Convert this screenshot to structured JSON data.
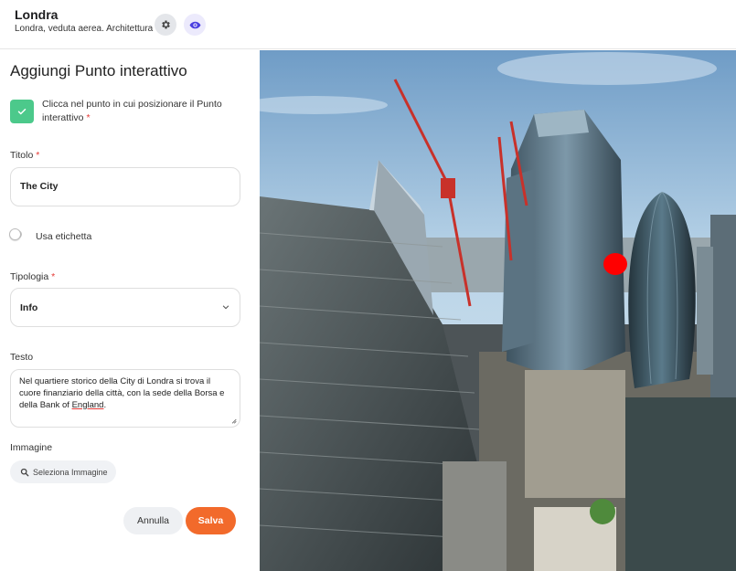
{
  "header": {
    "title": "Londra",
    "subtitle": "Londra, veduta aerea. Architettura",
    "settings_icon": "gear-icon",
    "preview_icon": "eye-icon"
  },
  "panel": {
    "title": "Aggiungi Punto interattivo",
    "instruction": "Clicca nel punto in cui posizionare il Punto interattivo",
    "required_mark": "*",
    "title_field": {
      "label": "Titolo",
      "value": "The City"
    },
    "label_toggle": {
      "label": "Usa etichetta",
      "checked": false
    },
    "type_field": {
      "label": "Tipologia",
      "value": "Info"
    },
    "text_field": {
      "label": "Testo",
      "value_before": "Nel quartiere storico della City di Londra si trova il cuore finanziario della città, con la sede della Borsa e della Bank of ",
      "value_underlined": "England",
      "value_after": "."
    },
    "image_field": {
      "label": "Immagine",
      "button_label": "Seleziona Immagine"
    },
    "cancel_label": "Annulla",
    "save_label": "Salva"
  },
  "image": {
    "hotspot_color": "#ff0000"
  },
  "colors": {
    "accent": "#f26a2b",
    "check_green": "#4cc98b",
    "required_red": "#e53935"
  }
}
